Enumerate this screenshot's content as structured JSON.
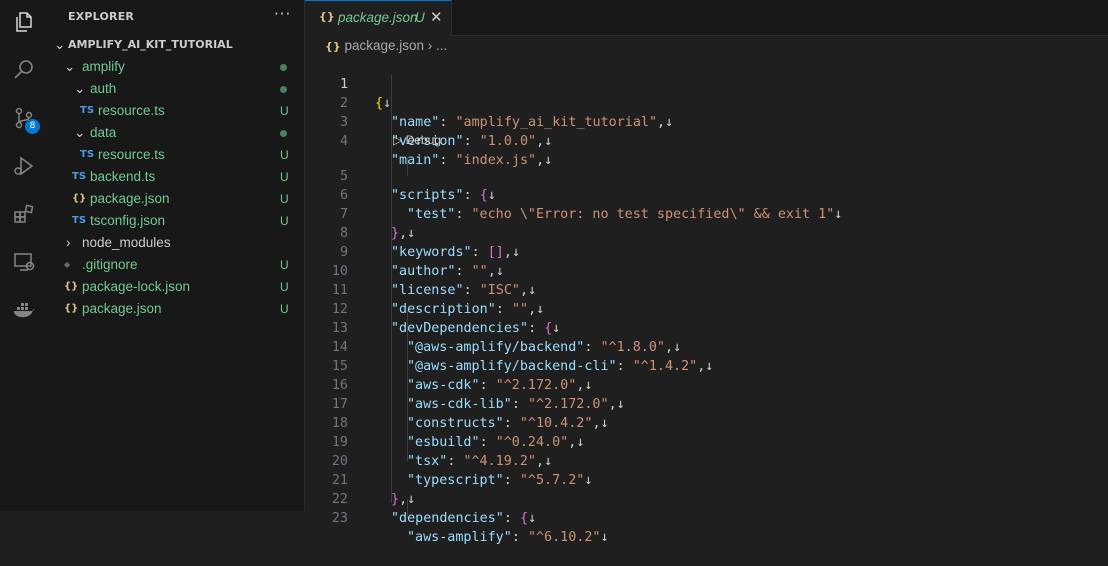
{
  "explorer": {
    "title": "EXPLORER",
    "more": "···",
    "root": "AMPLIFY_AI_KIT_TUTORIAL",
    "items": [
      {
        "label": "amplify",
        "status": ""
      },
      {
        "label": "auth",
        "status": ""
      },
      {
        "icon": "TS",
        "label": "resource.ts",
        "status": "U"
      },
      {
        "label": "data",
        "status": ""
      },
      {
        "icon": "TS",
        "label": "resource.ts",
        "status": "U"
      },
      {
        "icon": "TS",
        "label": "backend.ts",
        "status": "U"
      },
      {
        "icon": "{}",
        "label": "package.json",
        "status": "U"
      },
      {
        "icon": "TS",
        "label": "tsconfig.json",
        "status": "U"
      },
      {
        "label": "node_modules",
        "status": ""
      },
      {
        "icon": "◆",
        "label": ".gitignore",
        "status": "U"
      },
      {
        "icon": "{}",
        "label": "package-lock.json",
        "status": "U"
      },
      {
        "icon": "{}",
        "label": "package.json",
        "status": "U"
      }
    ]
  },
  "activity": {
    "scm_badge": "8"
  },
  "tab": {
    "icon": "{}",
    "name": "package.json",
    "status": "U",
    "close": "✕"
  },
  "breadcrumb": {
    "icon": "{}",
    "file": "package.json",
    "sep": "›",
    "more": "..."
  },
  "codelens": {
    "label": "Debug"
  },
  "code": {
    "return_glyph": "↓",
    "line_numbers": [
      "1",
      "2",
      "3",
      "4",
      "5",
      "6",
      "7",
      "8",
      "9",
      "10",
      "11",
      "12",
      "13",
      "14",
      "15",
      "16",
      "17",
      "18",
      "19",
      "20",
      "21",
      "22",
      "23"
    ],
    "entries": {
      "name": [
        "\"name\"",
        "\"amplify_ai_kit_tutorial\""
      ],
      "version": [
        "\"version\"",
        "\"1.0.0\""
      ],
      "main": [
        "\"main\"",
        "\"index.js\""
      ],
      "scripts": [
        "\"scripts\""
      ],
      "test": [
        "\"test\"",
        "\"echo \\\"Error: no test specified\\\" && exit 1\""
      ],
      "keywords": [
        "\"keywords\""
      ],
      "author": [
        "\"author\"",
        "\"\""
      ],
      "license": [
        "\"license\"",
        "\"ISC\""
      ],
      "description": [
        "\"description\"",
        "\"\""
      ],
      "devDependencies": [
        "\"devDependencies\""
      ],
      "d1": [
        "\"@aws-amplify/backend\"",
        "\"^1.8.0\""
      ],
      "d2": [
        "\"@aws-amplify/backend-cli\"",
        "\"^1.4.2\""
      ],
      "d3": [
        "\"aws-cdk\"",
        "\"^2.172.0\""
      ],
      "d4": [
        "\"aws-cdk-lib\"",
        "\"^2.172.0\""
      ],
      "d5": [
        "\"constructs\"",
        "\"^10.4.2\""
      ],
      "d6": [
        "\"esbuild\"",
        "\"^0.24.0\""
      ],
      "d7": [
        "\"tsx\"",
        "\"^4.19.2\""
      ],
      "d8": [
        "\"typescript\"",
        "\"^5.7.2\""
      ],
      "dependencies": [
        "\"dependencies\""
      ],
      "p1": [
        "\"aws-amplify\"",
        "\"^6.10.2\""
      ]
    }
  },
  "colors": {
    "accent": "#0078d4",
    "untracked": "#73c991",
    "string": "#ce9178",
    "key": "#9cdcfe",
    "bracket1": "#ffd700",
    "bracket2": "#da70d6",
    "bracket3": "#179fff"
  }
}
